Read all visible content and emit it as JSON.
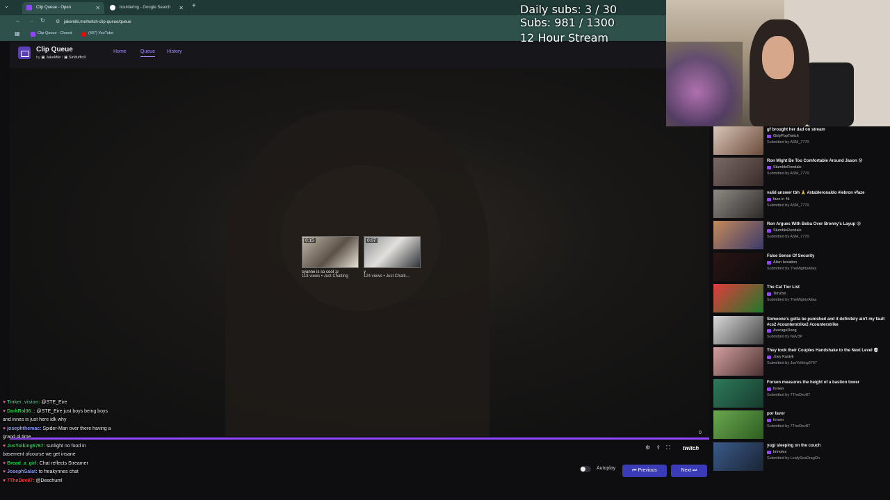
{
  "browser": {
    "tabs": [
      {
        "title": "Clip Queue - Open",
        "color": "#9147ff"
      },
      {
        "title": "bouldering - Google Search",
        "color": "#ffffff"
      }
    ],
    "new_tab": "+",
    "url": "jakemiki.me/twitch-clip-queue/queue",
    "bookmarks": [
      {
        "label": "Clip Queue - Closed",
        "color": "#9147ff"
      },
      {
        "label": "(407) YouTube",
        "color": "#ff0000"
      }
    ]
  },
  "app": {
    "title": "Clip Queue",
    "by": "by",
    "authors": [
      "JakeMiki",
      "SirMuffin9"
    ],
    "nav": {
      "home": "Home",
      "queue": "Queue",
      "history": "History"
    }
  },
  "overlay": {
    "daily_subs": "Daily subs: 3 / 30",
    "subs": "Subs: 981 / 1300",
    "stream": "12 Hour Stream"
  },
  "player": {
    "endcards": [
      {
        "duration": "0:15",
        "title": "syanne is so cool :p",
        "meta": "118 views • Just Chatting"
      },
      {
        "duration": "0:07",
        "title": "y",
        "meta": "124 views • Just Chatti..."
      }
    ],
    "time": "0",
    "logo": "twitch",
    "progress": 1.0
  },
  "controls": {
    "autoplay": "Autoplay",
    "previous": "Previous",
    "next": "Next"
  },
  "chat": [
    {
      "user": "Tinker_vision:",
      "msg": "@STE_Eire",
      "color": "#3cb371"
    },
    {
      "user": "DarkRal06_:",
      "msg": "@STE_Eire just boys being boys",
      "color": "#1fd14a"
    },
    {
      "user": "",
      "msg": "and innes is just here idk why",
      "color": "#ffffff"
    },
    {
      "user": "josephthemac:",
      "msg": "Spider-Man over there having a",
      "color": "#8a9eff"
    },
    {
      "user": "",
      "msg": "grand ol time",
      "color": "#ffffff"
    },
    {
      "user": "JusYolking6767:",
      "msg": "sunlight no food in",
      "color": "#1fd14a"
    },
    {
      "user": "",
      "msg": "basement ofcourse we get insane",
      "color": "#ffffff"
    },
    {
      "user": "Bread_a_girl:",
      "msg": "Chat reflects Streamer",
      "color": "#1fd14a"
    },
    {
      "user": "JosephSalat:",
      "msg": "to freakynnes chat",
      "color": "#8a9eff"
    },
    {
      "user": "7TheDev87:",
      "msg": "@Deschuml",
      "color": "#ff3b3b"
    }
  ],
  "queue": [
    {
      "title": "gf brought her dad on stream",
      "channel": "GirlyPopTwitch",
      "submitted": "Submitted by ASM_7770"
    },
    {
      "title": "Ron Might Be Too Comfortable Around Jason 😰",
      "channel": "StumbleRondale",
      "submitted": "Submitted by ASM_7770"
    },
    {
      "title": "valid answer tbh 🙏 #stableronaldo #lebron #faze",
      "channel": "faze in 4k",
      "submitted": "Submitted by ASM_7770"
    },
    {
      "title": "Ron Argues With Boba Over Bronny's Layup 😰",
      "channel": "StumbleRondale",
      "submitted": "Submitted by ASM_7770"
    },
    {
      "title": "False Sense Of Security",
      "channel": "Allen Isolation",
      "submitted": "Submitted by TheMightyAtlas"
    },
    {
      "title": "The Cat Tier List",
      "channel": "TimZoo",
      "submitted": "Submitted by TheMightyAtlas"
    },
    {
      "title": "Someone's gotta be punished and it definitely ain't my fault #cs2 #counterstrike2 #counterstrike",
      "channel": "AverageDong",
      "submitted": "Submitted by NaV3P"
    },
    {
      "title": "They took their Couples Handshake to the Next Level 💀",
      "channel": "Joey Kastyk",
      "submitted": "Submitted by JusYolking6767"
    },
    {
      "title": "Forsen measures the height of a bastion tower",
      "channel": "forsen",
      "submitted": "Submitted by 7TheDev87"
    },
    {
      "title": "por favor",
      "channel": "forsen",
      "submitted": "Submitted by 7TheDev87"
    },
    {
      "title": "yugi sleeping on the couch",
      "channel": "brinolex",
      "submitted": "Submitted by LeafySeaDragOn"
    }
  ]
}
